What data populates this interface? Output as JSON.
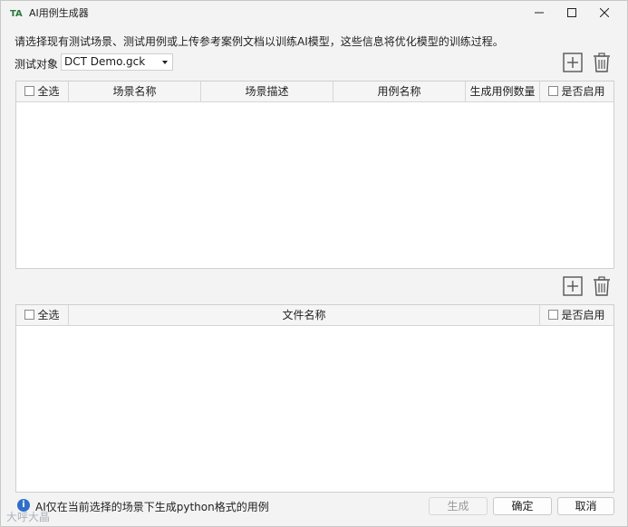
{
  "window": {
    "title": "AI用例生成器",
    "controls": {
      "minimize": "minimize-icon",
      "maximize": "maximize-icon",
      "close": "close-icon"
    }
  },
  "description": "请选择现有测试场景、测试用例或上传参考案例文档以训练AI模型，这些信息将优化模型的训练过程。",
  "target": {
    "label": "测试对象",
    "selected": "DCT Demo.gck"
  },
  "scenario_table": {
    "select_all": "全选",
    "columns": [
      "场景名称",
      "场景描述",
      "用例名称",
      "生成用例数量"
    ],
    "enabled_col": "是否启用",
    "rows": []
  },
  "file_table": {
    "select_all": "全选",
    "columns": [
      "文件名称"
    ],
    "enabled_col": "是否启用",
    "rows": []
  },
  "footer": {
    "info": "AI仅在当前选择的场景下生成python格式的用例",
    "generate": "生成",
    "confirm": "确定",
    "cancel": "取消"
  },
  "watermark": "大呼大晶"
}
